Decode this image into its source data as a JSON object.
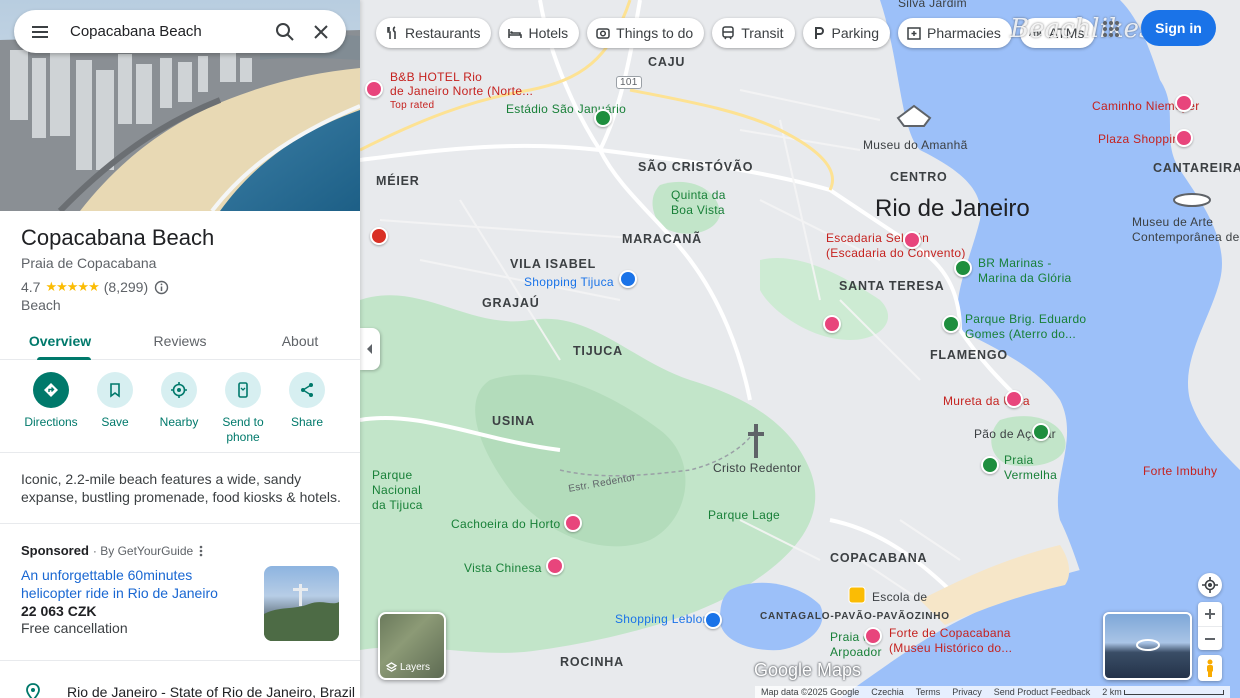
{
  "search": {
    "query": "Copacabana Beach"
  },
  "place": {
    "title": "Copacabana Beach",
    "subtitle": "Praia de Copacabana",
    "rating": "4.7",
    "stars": "★★★★★",
    "review_count": "(8,299)",
    "category": "Beach"
  },
  "tabs": [
    {
      "label": "Overview"
    },
    {
      "label": "Reviews"
    },
    {
      "label": "About"
    }
  ],
  "actions": [
    {
      "label": "Directions"
    },
    {
      "label": "Save"
    },
    {
      "label": "Nearby"
    },
    {
      "label": "Send to phone"
    },
    {
      "label": "Share"
    }
  ],
  "description": "Iconic, 2.2-mile beach features a wide, sandy expanse, bustling promenade, food kiosks & hotels.",
  "ad": {
    "sponsored": "Sponsored",
    "by": "· By GetYourGuide",
    "title": "An unforgettable 60minutes helicopter ride in Rio de Janeiro",
    "price": "22 063 CZK",
    "cancellation": "Free cancellation"
  },
  "address": "Rio de Janeiro - State of Rio de Janeiro, Brazil",
  "chips": [
    {
      "label": "Restaurants"
    },
    {
      "label": "Hotels"
    },
    {
      "label": "Things to do"
    },
    {
      "label": "Transit"
    },
    {
      "label": "Parking"
    },
    {
      "label": "Pharmacies"
    },
    {
      "label": "ATMs"
    }
  ],
  "header": {
    "sign_in": "Sign in",
    "watermark": "Beachlikes.ru"
  },
  "map": {
    "labels": {
      "bb_hotel": "B&B HOTEL Rio de Janeiro Norte (Norte...",
      "bb_hotel_l1": "B&B HOTEL Rio",
      "bb_hotel_l2": "de Janeiro Norte (Norte...",
      "top_rated": "Top rated",
      "caju": "CAJU",
      "estadio": "Estádio São Januário",
      "sao_cristovao": "SÃO CRISTÓVÃO",
      "meier": "MÉIER",
      "quinta": "Quinta da",
      "quinta2": "Boa Vista",
      "museu_amanha": "Museu do Amanhã",
      "centro": "CENTRO",
      "rio": "Rio de Janeiro",
      "maracana": "MARACANÃ",
      "escadaria": "Escadaria Selarón",
      "escadaria2": "(Escadaria do Convento)",
      "vila_isabel": "VILA ISABEL",
      "shopping_tijuca": "Shopping Tijuca",
      "grajau": "GRAJAÚ",
      "santa_teresa": "SANTA TERESA",
      "tijuca": "TIJUCA",
      "flamengo": "FLAMENGO",
      "usina": "USINA",
      "cristo": "Cristo Redentor",
      "parque_nacional": "Parque",
      "parque_nacional2": "Nacional",
      "parque_nacional3": "da Tijuca",
      "estr_redentor": "Estr. Redentor",
      "cachoeira": "Cachoeira do Horto",
      "parque_lage": "Parque Lage",
      "vista_chinesa": "Vista Chinesa",
      "copacabana": "COPACABANA",
      "cantagalo": "CANTAGALO-PAVÃO-PAVÃOZINHO",
      "shopping_leblon": "Shopping Leblon",
      "praia_do_arpoador": "Praia do",
      "praia_do_arpoador2": "Arpoador",
      "rocinha": "ROCINHA",
      "escola_de_samba": "Escola de",
      "forte": "Forte de Copacabana",
      "forte2": "(Museu Histórico do...",
      "caminho": "Caminho Niemeyer",
      "plaza_shopping": "Plaza Shopping",
      "cantareira": "CANTAREIRA",
      "mac": "Museu de Arte",
      "mac2": "Contemporânea de...",
      "br_marinas": "BR Marinas -",
      "br_marinas2": "Marina da Glória",
      "praia_brig": "Parque Brig. Eduardo",
      "praia_brig2": "Gomes (Aterro do...",
      "mureta": "Mureta da Urca",
      "pao_acucar": "Pão de Açúcar",
      "forte_imbuhy": "Forte Imbuhy",
      "praia_vermelha": "Praia",
      "praia_vermelha2": "Vermelha",
      "sivia": "Silva Jardim",
      "route_101": "101"
    },
    "layers": "Layers",
    "google_logo": "Google Maps",
    "footer": [
      "Map data ©2025 Google",
      "Czechia",
      "Terms",
      "Privacy",
      "Send Product Feedback"
    ],
    "scale": "2 km"
  },
  "colors": {
    "accent": "#00796b",
    "link": "#1967d2",
    "star": "#fbbc04",
    "water": "#9cc0f9",
    "park": "#bfe6c6",
    "primary_button": "#1a73e8"
  }
}
